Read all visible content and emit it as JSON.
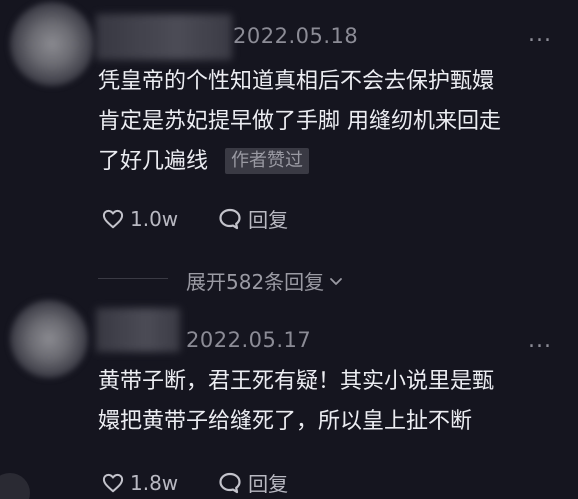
{
  "comments": [
    {
      "date": "2022.05.18",
      "more": "...",
      "lines": [
        "凭皇帝的个性知道真相后不会去保护甄嬛",
        "肯定是苏妃提早做了手脚 用缝纫机来回走",
        "了好几遍线"
      ],
      "badge": "作者赞过",
      "likes": "1.0w",
      "reply": "回复"
    },
    {
      "date": "2022.05.17",
      "more": "...",
      "lines": [
        "黄带子断，君王死有疑！其实小说里是甄",
        "嬛把黄带子给缝死了，所以皇上扯不断"
      ],
      "likes": "1.8w",
      "reply": "回复"
    }
  ],
  "expand_replies": "展开582条回复",
  "icons": {
    "like": "heart-outline-icon",
    "reply": "speech-bubble-icon",
    "more": "more-dots-icon",
    "expand": "chevron-down-icon"
  },
  "colors": {
    "background": "#15151f",
    "text": "#ecedf2",
    "muted": "#8c8c96",
    "badge_bg": "#3a3a44"
  }
}
